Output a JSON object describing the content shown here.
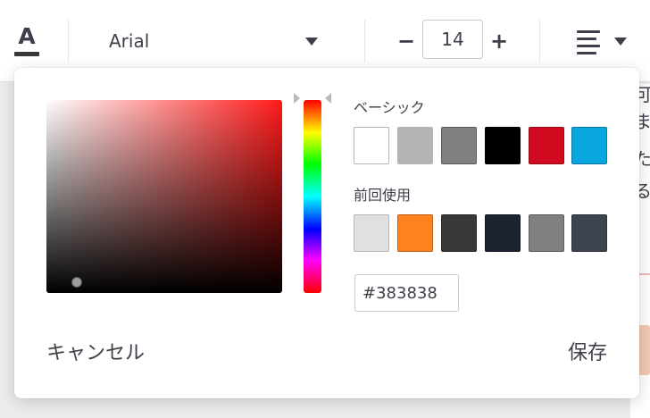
{
  "toolbar": {
    "font_color": {
      "icon": "font-color-icon",
      "glyph": "A",
      "current_color": "#383838"
    },
    "font_family": {
      "value": "Arial",
      "icon": "chevron-down-icon"
    },
    "font_size": {
      "minus_label": "−",
      "value": "14",
      "plus_label": "+"
    },
    "align": {
      "icon": "align-left-icon",
      "caret_icon": "chevron-down-icon"
    }
  },
  "color_picker": {
    "hue_color": "#ff1a1a",
    "basic_label": "ベーシック",
    "basic_colors": [
      "#ffffff",
      "#b3b3b3",
      "#808080",
      "#000000",
      "#d10a1f",
      "#0aa6e0"
    ],
    "recent_label": "前回使用",
    "recent_colors": [
      "#e0e0e0",
      "#ff8320",
      "#383838",
      "#1d2230",
      "#808080",
      "#3e4550"
    ],
    "hex_value": "#383838",
    "cancel_label": "キャンセル",
    "save_label": "保存"
  },
  "background_doc": {
    "line_chars": [
      "可",
      "ま",
      "た",
      "る"
    ],
    "accent_colors": [
      "#f0b8b8",
      "#f2c9b4"
    ]
  }
}
